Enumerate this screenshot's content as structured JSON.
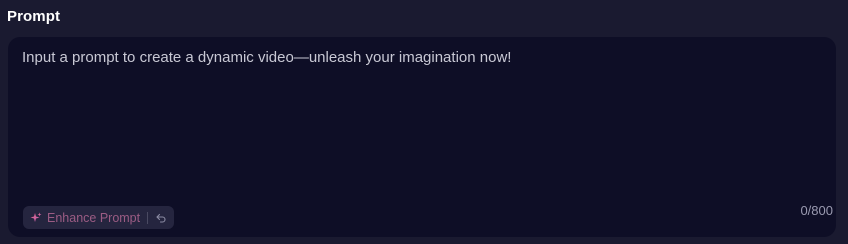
{
  "section": {
    "title": "Prompt"
  },
  "prompt": {
    "value": "",
    "placeholder": "Input a prompt to create a dynamic video—unleash your imagination now!",
    "char_count": "0/800"
  },
  "enhance": {
    "label": "Enhance Prompt",
    "icon": "sparkle-icon",
    "undo_icon": "undo-icon"
  },
  "colors": {
    "background": "#1a1a30",
    "input_background": "#0e0e26",
    "enhance_label": "#9b5c84",
    "sparkle_gradient_start": "#e06a8a",
    "sparkle_gradient_end": "#c25db0"
  }
}
